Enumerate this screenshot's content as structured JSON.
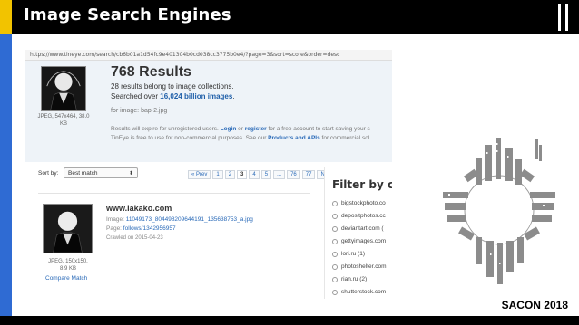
{
  "slide": {
    "title": "Image Search Engines",
    "footer": "SACON 2018"
  },
  "browser": {
    "url": "https://www.tineye.com/search/cb6b01a1d54fc9e401304b0cd038cc3775b0e4/?page=3&sort=score&order=desc"
  },
  "query": {
    "caption_size": "JPEG, 547x464, 38.0",
    "caption_kb": "KB",
    "results_count": "768 Results",
    "collections": "28 results belong to image collections.",
    "searched_prefix": "Searched over ",
    "searched_value": "16,024 billion images",
    "searched_suffix": ".",
    "for_image": "for image: bap-2.jpg",
    "notice1_a": "Results will expire for unregistered users. ",
    "notice1_login": "Login",
    "notice1_or": " or ",
    "notice1_register": "register",
    "notice1_b": " for a free account to start saving your s",
    "notice2_a": "TinEye is free to use for non-commercial purposes. See our ",
    "notice2_link": "Products and APIs",
    "notice2_b": " for commercial sol"
  },
  "controls": {
    "sort_label": "Sort by:",
    "sort_value": "Best match",
    "sort_chevron": "⬍",
    "pager": [
      "« Prev",
      "1",
      "2",
      "3",
      "4",
      "5",
      "...",
      "76",
      "77",
      "Next »"
    ],
    "pager_current": "3"
  },
  "result": {
    "domain": "www.lakako.com",
    "image_label": "Image: ",
    "image_value": "11049173_804498209644191_135638753_a.jpg",
    "page_label": "Page: ",
    "page_value": "follows/1342956957",
    "crawled": "Crawled on 2015-04-23",
    "thumb_caption_size": "JPEG, 150x150,",
    "thumb_caption_kb": "8.9 KB",
    "compare": "Compare Match"
  },
  "filter": {
    "title": "Filter by co",
    "items": [
      "bigstockphoto.co",
      "depositphotos.cc",
      "deviantart.com (",
      "gettyimages.com",
      "lori.ru (1)",
      "photoshelter.com",
      "rian.ru (2)",
      "shutterstock.com"
    ]
  },
  "colors": {
    "accent_yellow": "#f2c300",
    "accent_blue": "#2f6bd3",
    "link_blue": "#2a6ab8"
  }
}
